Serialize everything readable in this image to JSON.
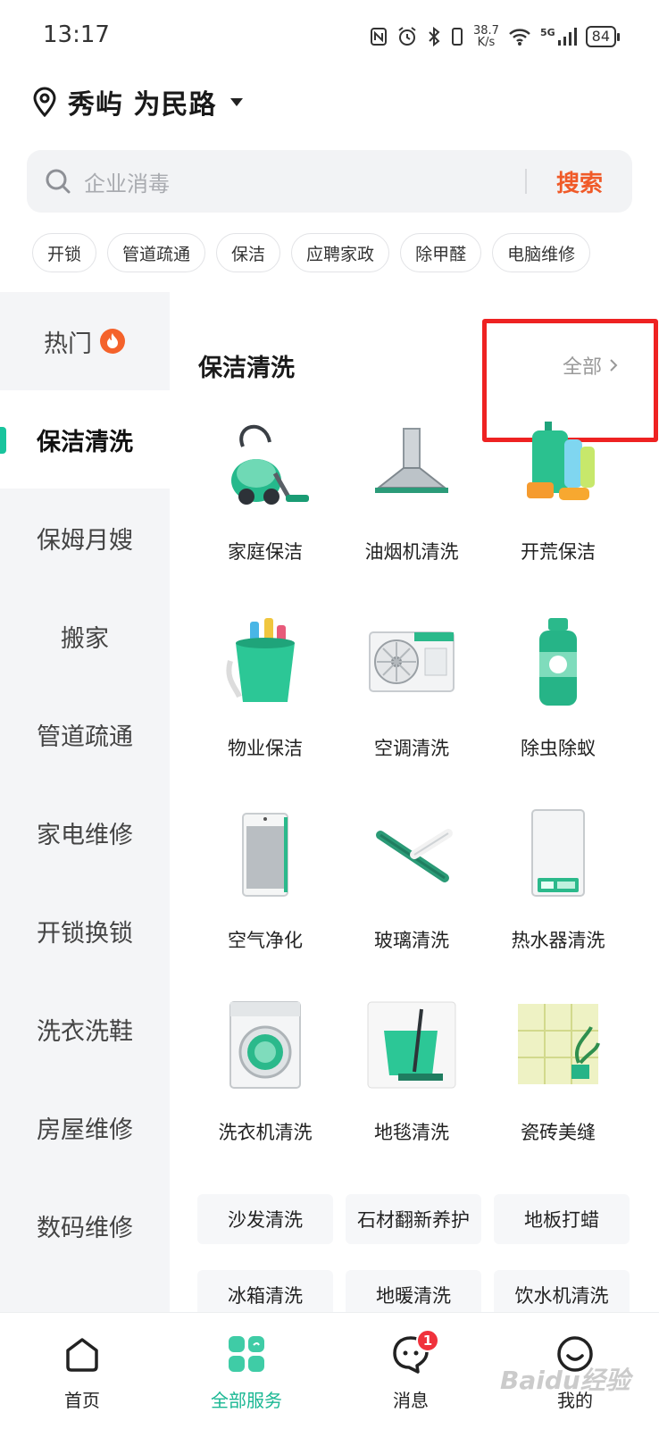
{
  "status_bar": {
    "time": "13:17",
    "net_speed_value": "38.7",
    "net_speed_unit": "K/s",
    "signal_label": "5G",
    "battery": "84",
    "icons": [
      "nfc-icon",
      "alarm-icon",
      "bluetooth-icon",
      "vibrate-icon",
      "wifi-icon",
      "signal-icon",
      "battery-icon"
    ]
  },
  "location": {
    "text": "秀屿 为民路"
  },
  "search": {
    "placeholder": "企业消毒",
    "button_label": "搜索"
  },
  "chips": [
    "开锁",
    "管道疏通",
    "保洁",
    "应聘家政",
    "除甲醛",
    "电脑维修"
  ],
  "sidebar": {
    "hot_label": "热门",
    "items": [
      "保洁清洗",
      "保姆月嫂",
      "搬家",
      "管道疏通",
      "家电维修",
      "开锁换锁",
      "洗衣洗鞋",
      "房屋维修",
      "数码维修"
    ],
    "active_index": 0
  },
  "section": {
    "title": "保洁清洗",
    "see_all": "全部"
  },
  "grid": [
    {
      "label": "家庭保洁",
      "icon": "vacuum-cleaner-icon"
    },
    {
      "label": "油烟机清洗",
      "icon": "range-hood-icon"
    },
    {
      "label": "开荒保洁",
      "icon": "cleaning-bottles-icon"
    },
    {
      "label": "物业保洁",
      "icon": "cleaning-bucket-icon"
    },
    {
      "label": "空调清洗",
      "icon": "ac-unit-icon"
    },
    {
      "label": "除虫除蚁",
      "icon": "insecticide-spray-icon"
    },
    {
      "label": "空气净化",
      "icon": "air-purifier-icon"
    },
    {
      "label": "玻璃清洗",
      "icon": "squeegee-icon"
    },
    {
      "label": "热水器清洗",
      "icon": "water-heater-icon"
    },
    {
      "label": "洗衣机清洗",
      "icon": "washing-machine-icon"
    },
    {
      "label": "地毯清洗",
      "icon": "mop-bucket-icon"
    },
    {
      "label": "瓷砖美缝",
      "icon": "tiles-plant-icon"
    }
  ],
  "text_tiles": [
    "沙发清洗",
    "石材翻新养护",
    "地板打蜡",
    "冰箱清洗",
    "地暖清洗",
    "饮水机清洗"
  ],
  "bottom_nav": [
    {
      "label": "首页",
      "icon": "home-icon"
    },
    {
      "label": "全部服务",
      "icon": "all-services-icon"
    },
    {
      "label": "消息",
      "icon": "message-icon",
      "badge": "1"
    },
    {
      "label": "我的",
      "icon": "profile-icon"
    }
  ],
  "colors": {
    "accent": "#19c49d",
    "search_button": "#f05a28",
    "badge": "#f0323c",
    "highlight_box": "#ee2222"
  },
  "watermark": "Baidu经验"
}
